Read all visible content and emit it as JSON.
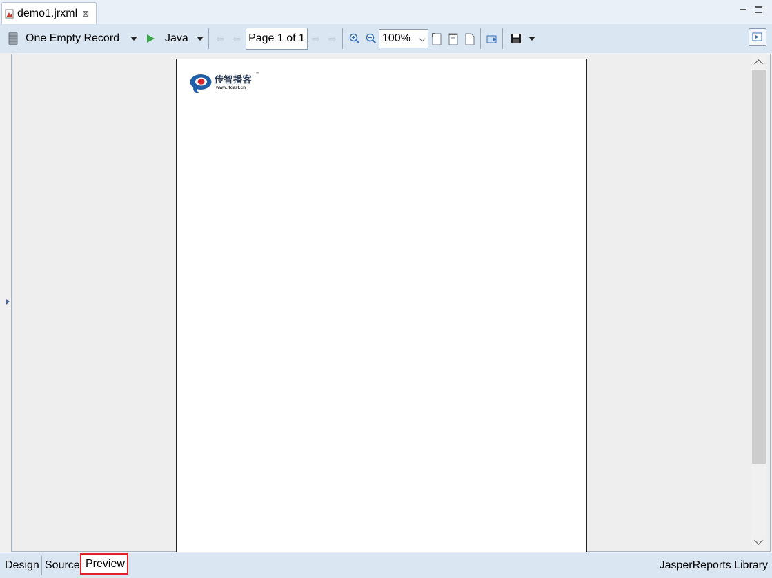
{
  "editor": {
    "tab_title": "demo1.jrxml",
    "close_glyph": "⊠"
  },
  "toolbar": {
    "data_adapter_label": "One Empty Record",
    "language_label": "Java",
    "page_indicator": "Page 1 of 1",
    "zoom_value": "100%",
    "icons": {
      "data_adapter": "database-icon",
      "run": "play-icon",
      "first_page": "first-page-arrow-icon",
      "prev_page": "prev-page-arrow-icon",
      "next_page": "next-page-arrow-icon",
      "last_page": "last-page-arrow-icon",
      "zoom_in": "zoom-in-icon",
      "zoom_out": "zoom-out-icon",
      "fit_page": "fit-page-icon",
      "fit_width": "fit-width-icon",
      "actual_size": "actual-size-icon",
      "export": "export-icon",
      "save": "save-icon"
    }
  },
  "report": {
    "logo_cn": "传智播客",
    "logo_tm": "™",
    "logo_url": "www.itcast.cn"
  },
  "bottom_tabs": {
    "design": "Design",
    "source": "Source",
    "preview": "Preview",
    "active": "Preview",
    "library": "JasperReports Library"
  },
  "colors": {
    "toolbar_bg": "#dbe6f3",
    "canvas_bg": "#eeeeee",
    "highlight": "#e0202a",
    "logo_blue": "#1f5ea8",
    "logo_red": "#d9232d"
  }
}
